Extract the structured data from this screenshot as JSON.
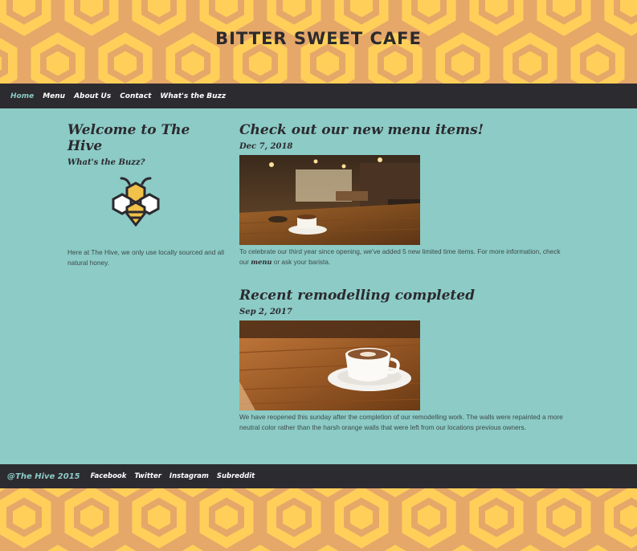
{
  "site": {
    "title": "BITTER SWEET CAFE"
  },
  "nav": {
    "items": [
      {
        "label": "Home",
        "active": true
      },
      {
        "label": "Menu"
      },
      {
        "label": "About Us"
      },
      {
        "label": "Contact"
      },
      {
        "label": "What's the Buzz"
      }
    ]
  },
  "sidebar": {
    "title": "Welcome to The Hive",
    "subtitle": "What's the Buzz?",
    "logo_icon": "bee-icon",
    "text": "Here at The Hive, we only use locally sourced and all natural honey."
  },
  "posts": [
    {
      "title": "Check out our new menu items!",
      "date": "Dec 7, 2018",
      "image": "cafe-interior-photo",
      "text_before": "To celebrate our third year since opening, we've added 5 new limited time items. For more information, check our ",
      "text_link": "menu",
      "text_after": " or ask your barista."
    },
    {
      "title": "Recent remodelling completed",
      "date": "Sep 2, 2017",
      "image": "coffee-cup-photo",
      "text": "We have reopened this sunday after the completion of our remodelling work. The walls were repainted a more neutral color rather than the harsh orange walls that were left from our locations previous owners."
    }
  ],
  "footer": {
    "copyright": "@The Hive 2015",
    "links": [
      "Facebook",
      "Twitter",
      "Instagram",
      "Subreddit"
    ]
  },
  "colors": {
    "honey": "#ffcf5a",
    "honeycomb": "#e5a869",
    "teal": "#8ccbc6",
    "dark": "#2c2b30"
  }
}
